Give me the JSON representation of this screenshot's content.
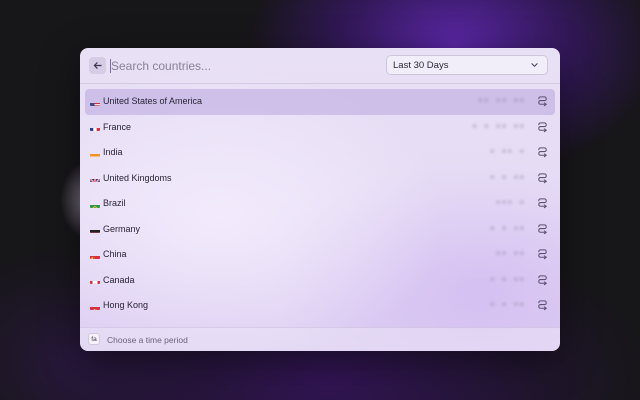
{
  "search": {
    "placeholder": "Search countries..."
  },
  "period_select": {
    "selected": "Last 30 Days"
  },
  "countries": [
    {
      "name": "United States of America",
      "flag": "us-flag-icon",
      "value": "▪▪ ▪▪ ▪▪",
      "selected": true
    },
    {
      "name": "France",
      "flag": "fr-flag-icon",
      "value": "▪ ▪ ▪▪ ▪▪"
    },
    {
      "name": "India",
      "flag": "in-flag-icon",
      "value": "▪ ▪▪ ▪"
    },
    {
      "name": "United Kingdoms",
      "flag": "gb-flag-icon",
      "value": "▪ ▪ ▪▪"
    },
    {
      "name": "Brazil",
      "flag": "br-flag-icon",
      "value": "▪▪▪ ▪"
    },
    {
      "name": "Germany",
      "flag": "de-flag-icon",
      "value": "▪ ▪ ▪▪"
    },
    {
      "name": "China",
      "flag": "cn-flag-icon",
      "value": "▪▪ ▪▪"
    },
    {
      "name": "Canada",
      "flag": "ca-flag-icon",
      "value": "▪ ▪ ▪▪"
    },
    {
      "name": "Hong Kong",
      "flag": "hk-flag-icon",
      "value": "▪ ▪ ▪▪"
    }
  ],
  "footer": {
    "logo_text": "fa",
    "hint": "Choose a time period"
  },
  "colors": {
    "panel": "#e6dcf5",
    "selected_row": "#c9b8e4",
    "text": "#2a2436",
    "muted": "#6b6478"
  }
}
